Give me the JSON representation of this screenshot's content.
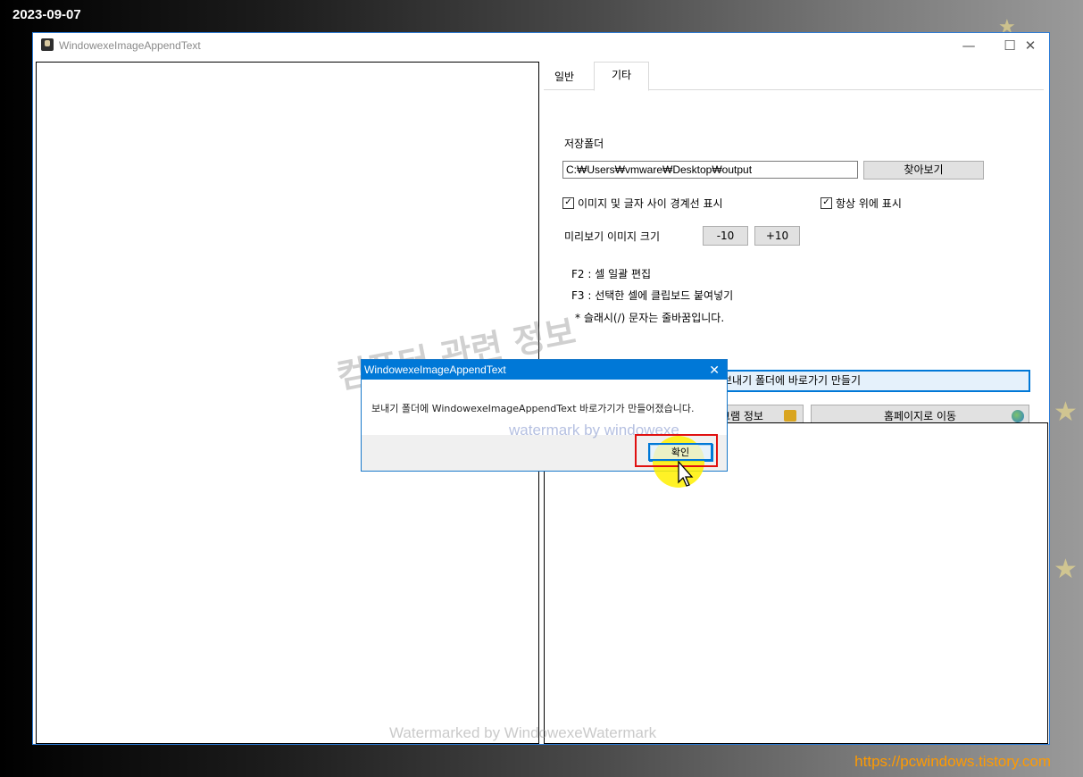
{
  "overlay": {
    "date": "2023-09-07",
    "site_url": "https://pcwindows.tistory.com",
    "watermark_korean": "컴퓨터 관련 정보",
    "watermark_en": "watermark by windowexe",
    "watermark_bottom": "Watermarked by WindowexeWatermark"
  },
  "window": {
    "title": "WindowexeImageAppendText",
    "minimize": "—",
    "maximize": "☐",
    "close": "✕"
  },
  "tabs": [
    {
      "label": "일반",
      "active": false
    },
    {
      "label": "기타",
      "active": true
    }
  ],
  "settings": {
    "save_folder_label": "저장폴더",
    "save_folder_value": "C:₩Users₩vmware₩Desktop₩output",
    "browse_button": "찾아보기",
    "show_border_label": "이미지 및 글자 사이 경계선 표시",
    "show_border_checked": true,
    "always_on_top_label": "항상 위에 표시",
    "always_on_top_checked": true,
    "preview_size_label": "미리보기 이미지 크기",
    "minus_button": "-10",
    "plus_button": "+10",
    "help_f2": "F2 : 셀 일괄 편집",
    "help_f3": "F3 : 선택한 셀에 클립보드 붙여넣기",
    "help_slash": "* 슬래시(/) 문자는 줄바꿈입니다.",
    "shortcut_button": "보내기 폴더에 바로가기 만들기",
    "program_info_button": "그램 정보",
    "homepage_button": "홈페이지로 이동"
  },
  "dialog": {
    "title": "WindowexeImageAppendText",
    "close": "✕",
    "message": "보내기 폴더에 WindowexeImageAppendText 바로가기가 만들어졌습니다.",
    "ok_button": "확인"
  },
  "colors": {
    "dialog_title_bg": "#0078d7",
    "highlight_box": "#e01010",
    "click_highlight": "#fff000",
    "url_color": "#ff9a00"
  }
}
